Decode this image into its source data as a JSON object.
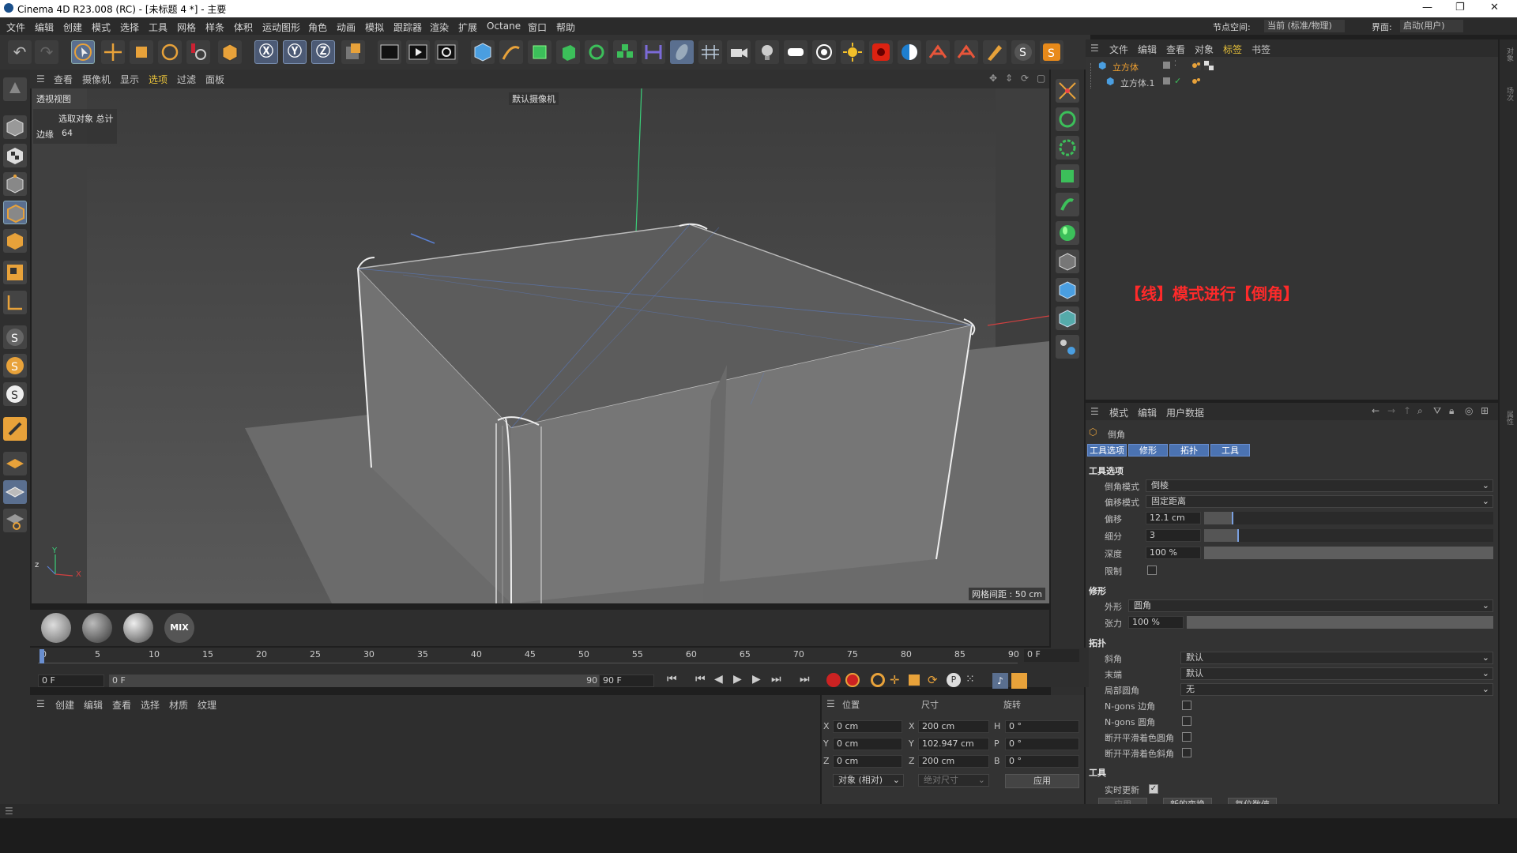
{
  "window": {
    "title": "Cinema 4D R23.008 (RC) - [未标题 4 *] - 主要"
  },
  "menubar": {
    "items": [
      "文件",
      "编辑",
      "创建",
      "模式",
      "选择",
      "工具",
      "网格",
      "样条",
      "体积",
      "运动图形",
      "角色",
      "动画",
      "模拟",
      "跟踪器",
      "渲染",
      "扩展",
      "Octane",
      "窗口",
      "帮助"
    ],
    "node_space_label": "节点空间:",
    "node_space_value": "当前 (标准/物理)",
    "layout_label": "界面:",
    "layout_value": "启动(用户)"
  },
  "viewport": {
    "menu": [
      "查看",
      "摄像机",
      "显示",
      "选项",
      "过滤",
      "面板"
    ],
    "view_name": "透视视图",
    "camera": "默认摄像机 ",
    "info_selected": "选取对象 总计",
    "info_edges_label": "边缘",
    "info_edges_value": "64",
    "grid_spacing": "网格间距 : 50 cm",
    "annotation": "【线】模式进行【倒角】"
  },
  "object_manager": {
    "menu": [
      "文件",
      "编辑",
      "查看",
      "对象",
      "标签",
      "书签"
    ],
    "objects": [
      {
        "name": "立方体",
        "selected": true
      },
      {
        "name": "立方体.1",
        "selected": false
      }
    ]
  },
  "attributes": {
    "menu": [
      "模式",
      "编辑",
      "用户数据"
    ],
    "tool_name": "倒角",
    "tabs": [
      "工具选项",
      "修形",
      "拓扑",
      "工具"
    ],
    "sections": {
      "tool_options": "工具选项",
      "shaping": "修形",
      "topology": "拓扑",
      "tool": "工具"
    },
    "bevel_mode_label": "倒角模式",
    "bevel_mode_value": "倒棱",
    "offset_mode_label": "偏移模式",
    "offset_mode_value": "固定距离",
    "offset_label": "偏移",
    "offset_value": "12.1 cm",
    "offset_slider": 0.1,
    "subdiv_label": "细分",
    "subdiv_value": "3",
    "subdiv_slider": 0.12,
    "depth_label": "深度",
    "depth_value": "100 %",
    "depth_slider": 1.0,
    "limit_label": "限制",
    "shape_label": "外形",
    "shape_value": "圆角",
    "tension_label": "张力",
    "tension_value": "100 %",
    "tension_slider": 1.0,
    "miter_label": "斜角",
    "miter_value": "默认",
    "end_label": "末端",
    "end_value": "默认",
    "partial_label": "局部圆角",
    "partial_value": "无",
    "ngon_corner_label": "N-gons 边角",
    "ngon_round_label": "N-gons 圆角",
    "break_round_label": "断开平滑着色圆角",
    "break_miter_label": "断开平滑着色斜角",
    "realtime_label": "实时更新",
    "apply_label": "应用",
    "new_transform_label": "新的变换",
    "reset_label": "复位数值"
  },
  "timeline": {
    "ticks": [
      "0",
      "5",
      "10",
      "15",
      "20",
      "25",
      "30",
      "35",
      "40",
      "45",
      "50",
      "55",
      "60",
      "65",
      "70",
      "75",
      "80",
      "85",
      "90"
    ],
    "current_frame": "0 F",
    "start": "0 F",
    "range_start": "0 F",
    "range_end": "90 F",
    "end": "90 F"
  },
  "material_manager": {
    "menu": [
      "创建",
      "编辑",
      "查看",
      "选择",
      "材质",
      "纹理"
    ],
    "mix_label": "MIX"
  },
  "coordinates": {
    "headers": [
      "位置",
      "尺寸",
      "旋转"
    ],
    "pos": {
      "x": "0 cm",
      "y": "0 cm",
      "z": "0 cm"
    },
    "size": {
      "x": "200 cm",
      "y": "102.947 cm",
      "z": "200 cm"
    },
    "rot": {
      "h": "0 °",
      "p": "0 °",
      "b": "0 °"
    },
    "axis_x": "X",
    "axis_y": "Y",
    "axis_z": "Z",
    "rot_h": "H",
    "rot_p": "P",
    "rot_b": "B",
    "mode": "对象 (相对)",
    "size_mode": "绝对尺寸",
    "apply": "应用"
  },
  "colors": {
    "accent": "#4b73b2",
    "annotation": "#ff2a2a",
    "background": "#333333"
  }
}
